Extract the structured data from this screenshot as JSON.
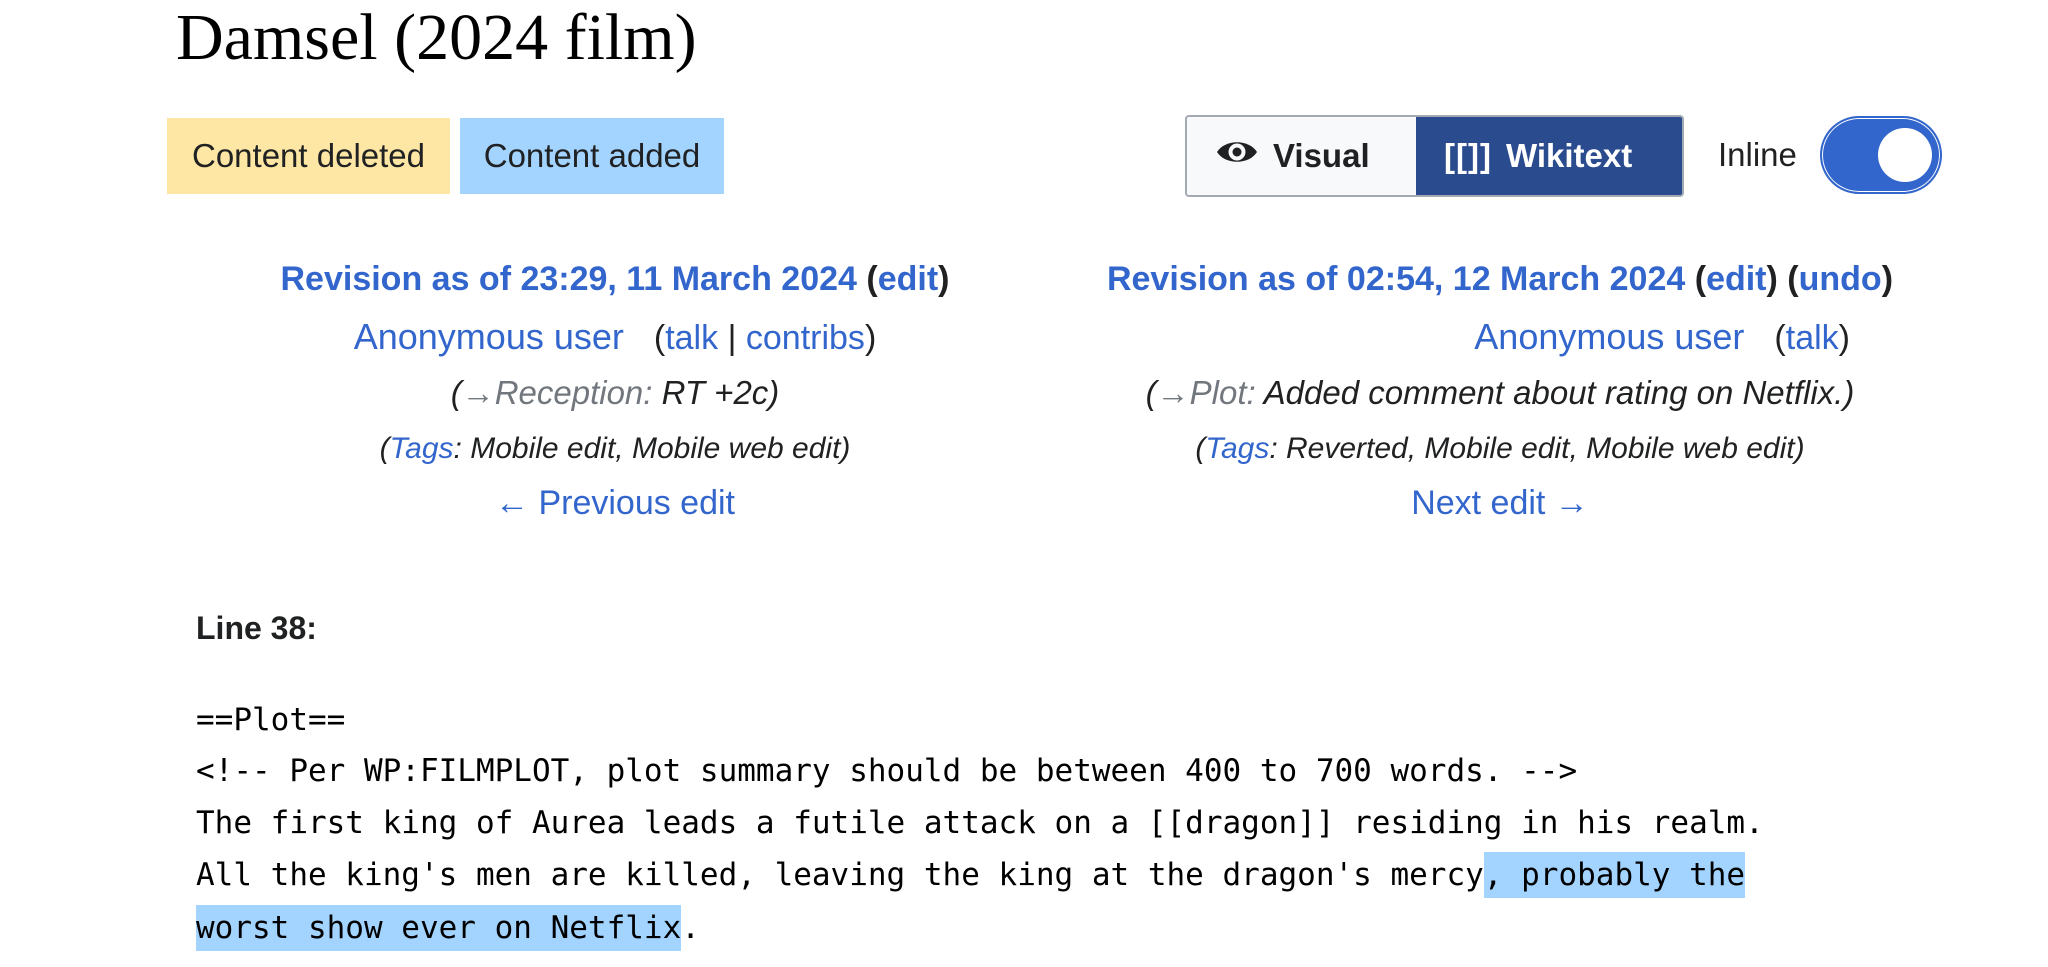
{
  "page": {
    "title": "Damsel (2024 film)"
  },
  "legend": {
    "deleted_label": "Content deleted",
    "added_label": "Content added",
    "deleted_color": "#fee7a4",
    "added_color": "#a3d3ff"
  },
  "view_modes": {
    "visual_label": "Visual",
    "visual_icon": "eye-icon",
    "wikitext_label": "Wikitext",
    "wikitext_glyph": "[[]]",
    "active": "Wikitext",
    "active_color": "#2a4b8d"
  },
  "inline_toggle": {
    "label": "Inline",
    "on": true,
    "color": "#3366cc"
  },
  "old_revision": {
    "heading": "Revision as of 23:29, 11 March 2024",
    "open_paren": "(",
    "edit_label": "edit",
    "close_paren": ")",
    "user": "Anonymous user",
    "user_tools_open": "(",
    "talk_label": "talk",
    "separator": "|",
    "contribs_label": "contribs",
    "user_tools_close": ")",
    "summary_open": "(",
    "summary_arrow": "→",
    "summary_section": "Reception:",
    "summary_text": " RT +2c)",
    "tags_open": "(",
    "tags_label": "Tags",
    "tags_text": ": Mobile edit, Mobile web edit)",
    "nav_label": "← Previous edit"
  },
  "new_revision": {
    "heading": "Revision as of 02:54, 12 March 2024",
    "open_paren": "(",
    "edit_label": "edit",
    "mid_paren": ") (",
    "undo_label": "undo",
    "close_paren": ")",
    "user": "Anonymous user",
    "user_tools_open": "(",
    "talk_label": "talk",
    "user_tools_close": ")",
    "summary_open": "(",
    "summary_arrow": "→",
    "summary_section": "Plot:",
    "summary_text": " Added comment about rating on Netflix.)",
    "tags_open": "(",
    "tags_label": "Tags",
    "tags_text": ": Reverted, Mobile edit, Mobile web edit)",
    "nav_label": "Next edit →"
  },
  "diff": {
    "line_number": "Line 38:",
    "lines": [
      "==Plot==",
      "<!-- Per WP:FILMPLOT, plot summary should be between 400 to 700 words. -->",
      "The first king of Aurea leads a futile attack on a [[dragon]] residing in his realm."
    ],
    "line4_plain": "All the king's men are killed, leaving the king at the dragon's mercy",
    "line4_added": ", probably the",
    "line5_added": "worst show ever on Netflix",
    "line5_plain": "."
  }
}
